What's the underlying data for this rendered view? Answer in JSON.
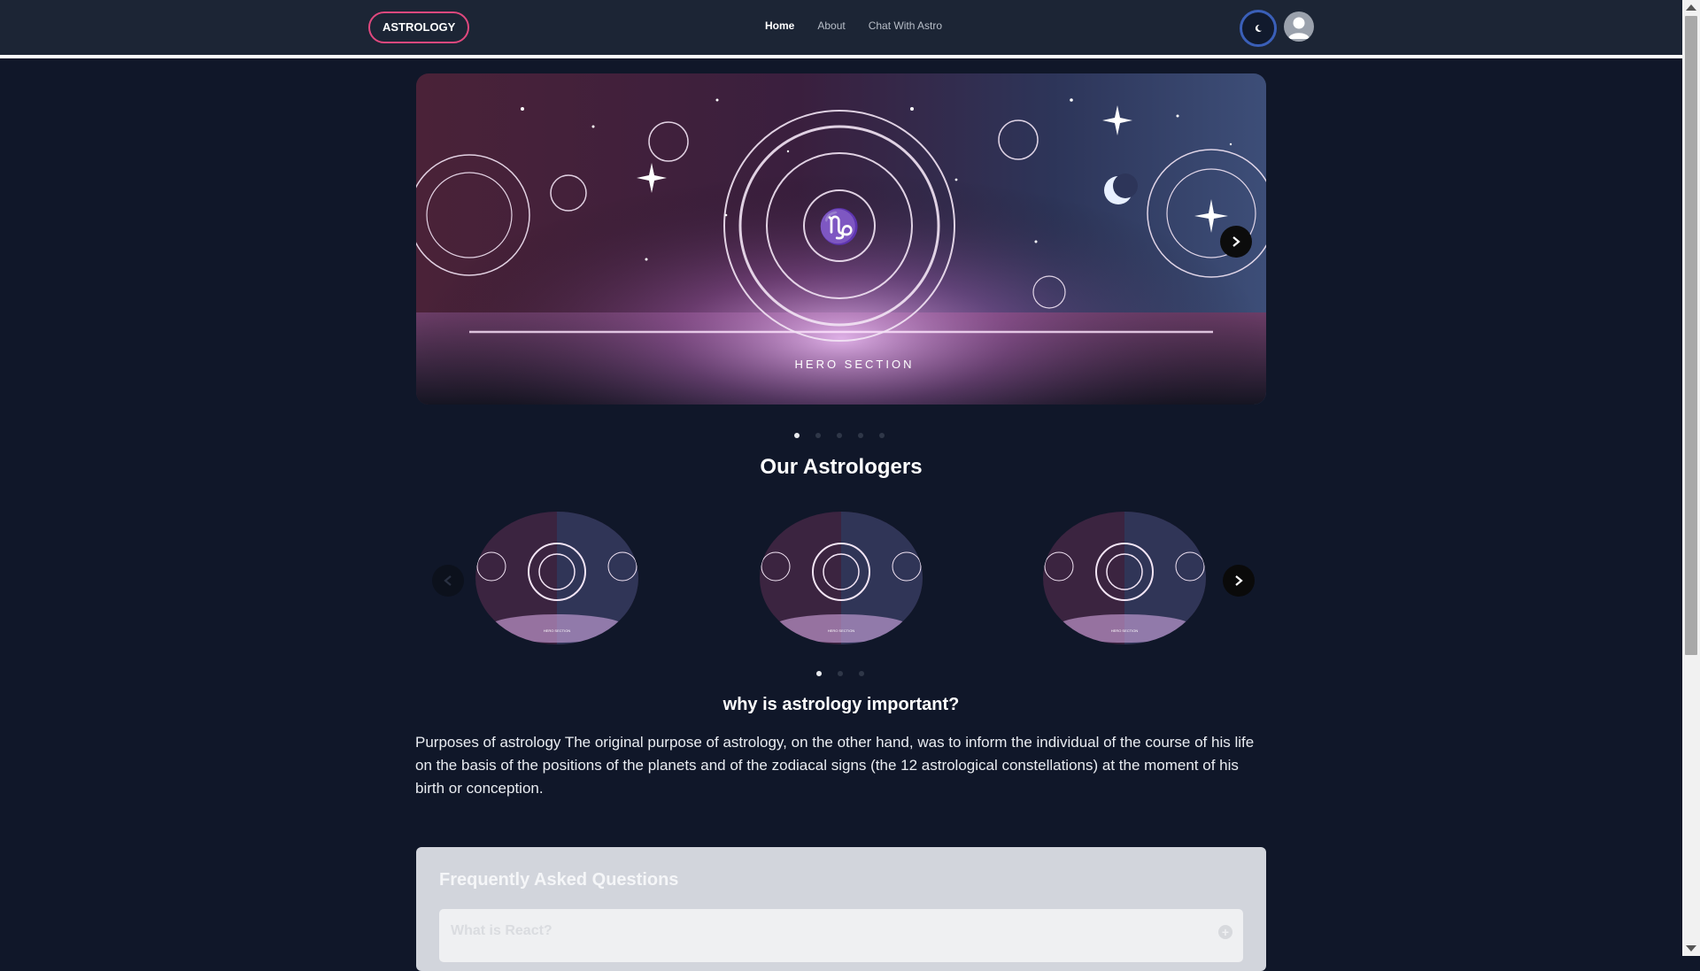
{
  "navbar": {
    "brand": "ASTROLOGY",
    "links": [
      {
        "label": "Home",
        "active": true
      },
      {
        "label": "About",
        "active": false
      },
      {
        "label": "Chat With Astro",
        "active": false
      }
    ],
    "theme_icon": "moon-icon",
    "avatar_icon": "user-icon"
  },
  "hero": {
    "image_caption": "HERO SECTION",
    "slide_count": 5,
    "active_slide": 1
  },
  "astrologers": {
    "title": "Our Astrologers",
    "card_caption": "HERO SECTION",
    "page_count": 3,
    "active_page": 1
  },
  "why": {
    "title": "why is astrology important?",
    "text": "Purposes of astrology The original purpose of astrology, on the other hand, was to inform the individual of the course of his life on the basis of the positions of the planets and of the zodiacal signs (the 12 astrological constellations) at the moment of his birth or conception."
  },
  "faq": {
    "title": "Frequently Asked Questions",
    "items": [
      {
        "question": "What is React?"
      }
    ]
  },
  "colors": {
    "background": "#101729",
    "navbar": "#1c2535",
    "brand_border": "#e0487e",
    "toggle_border": "#3a5fb8"
  }
}
